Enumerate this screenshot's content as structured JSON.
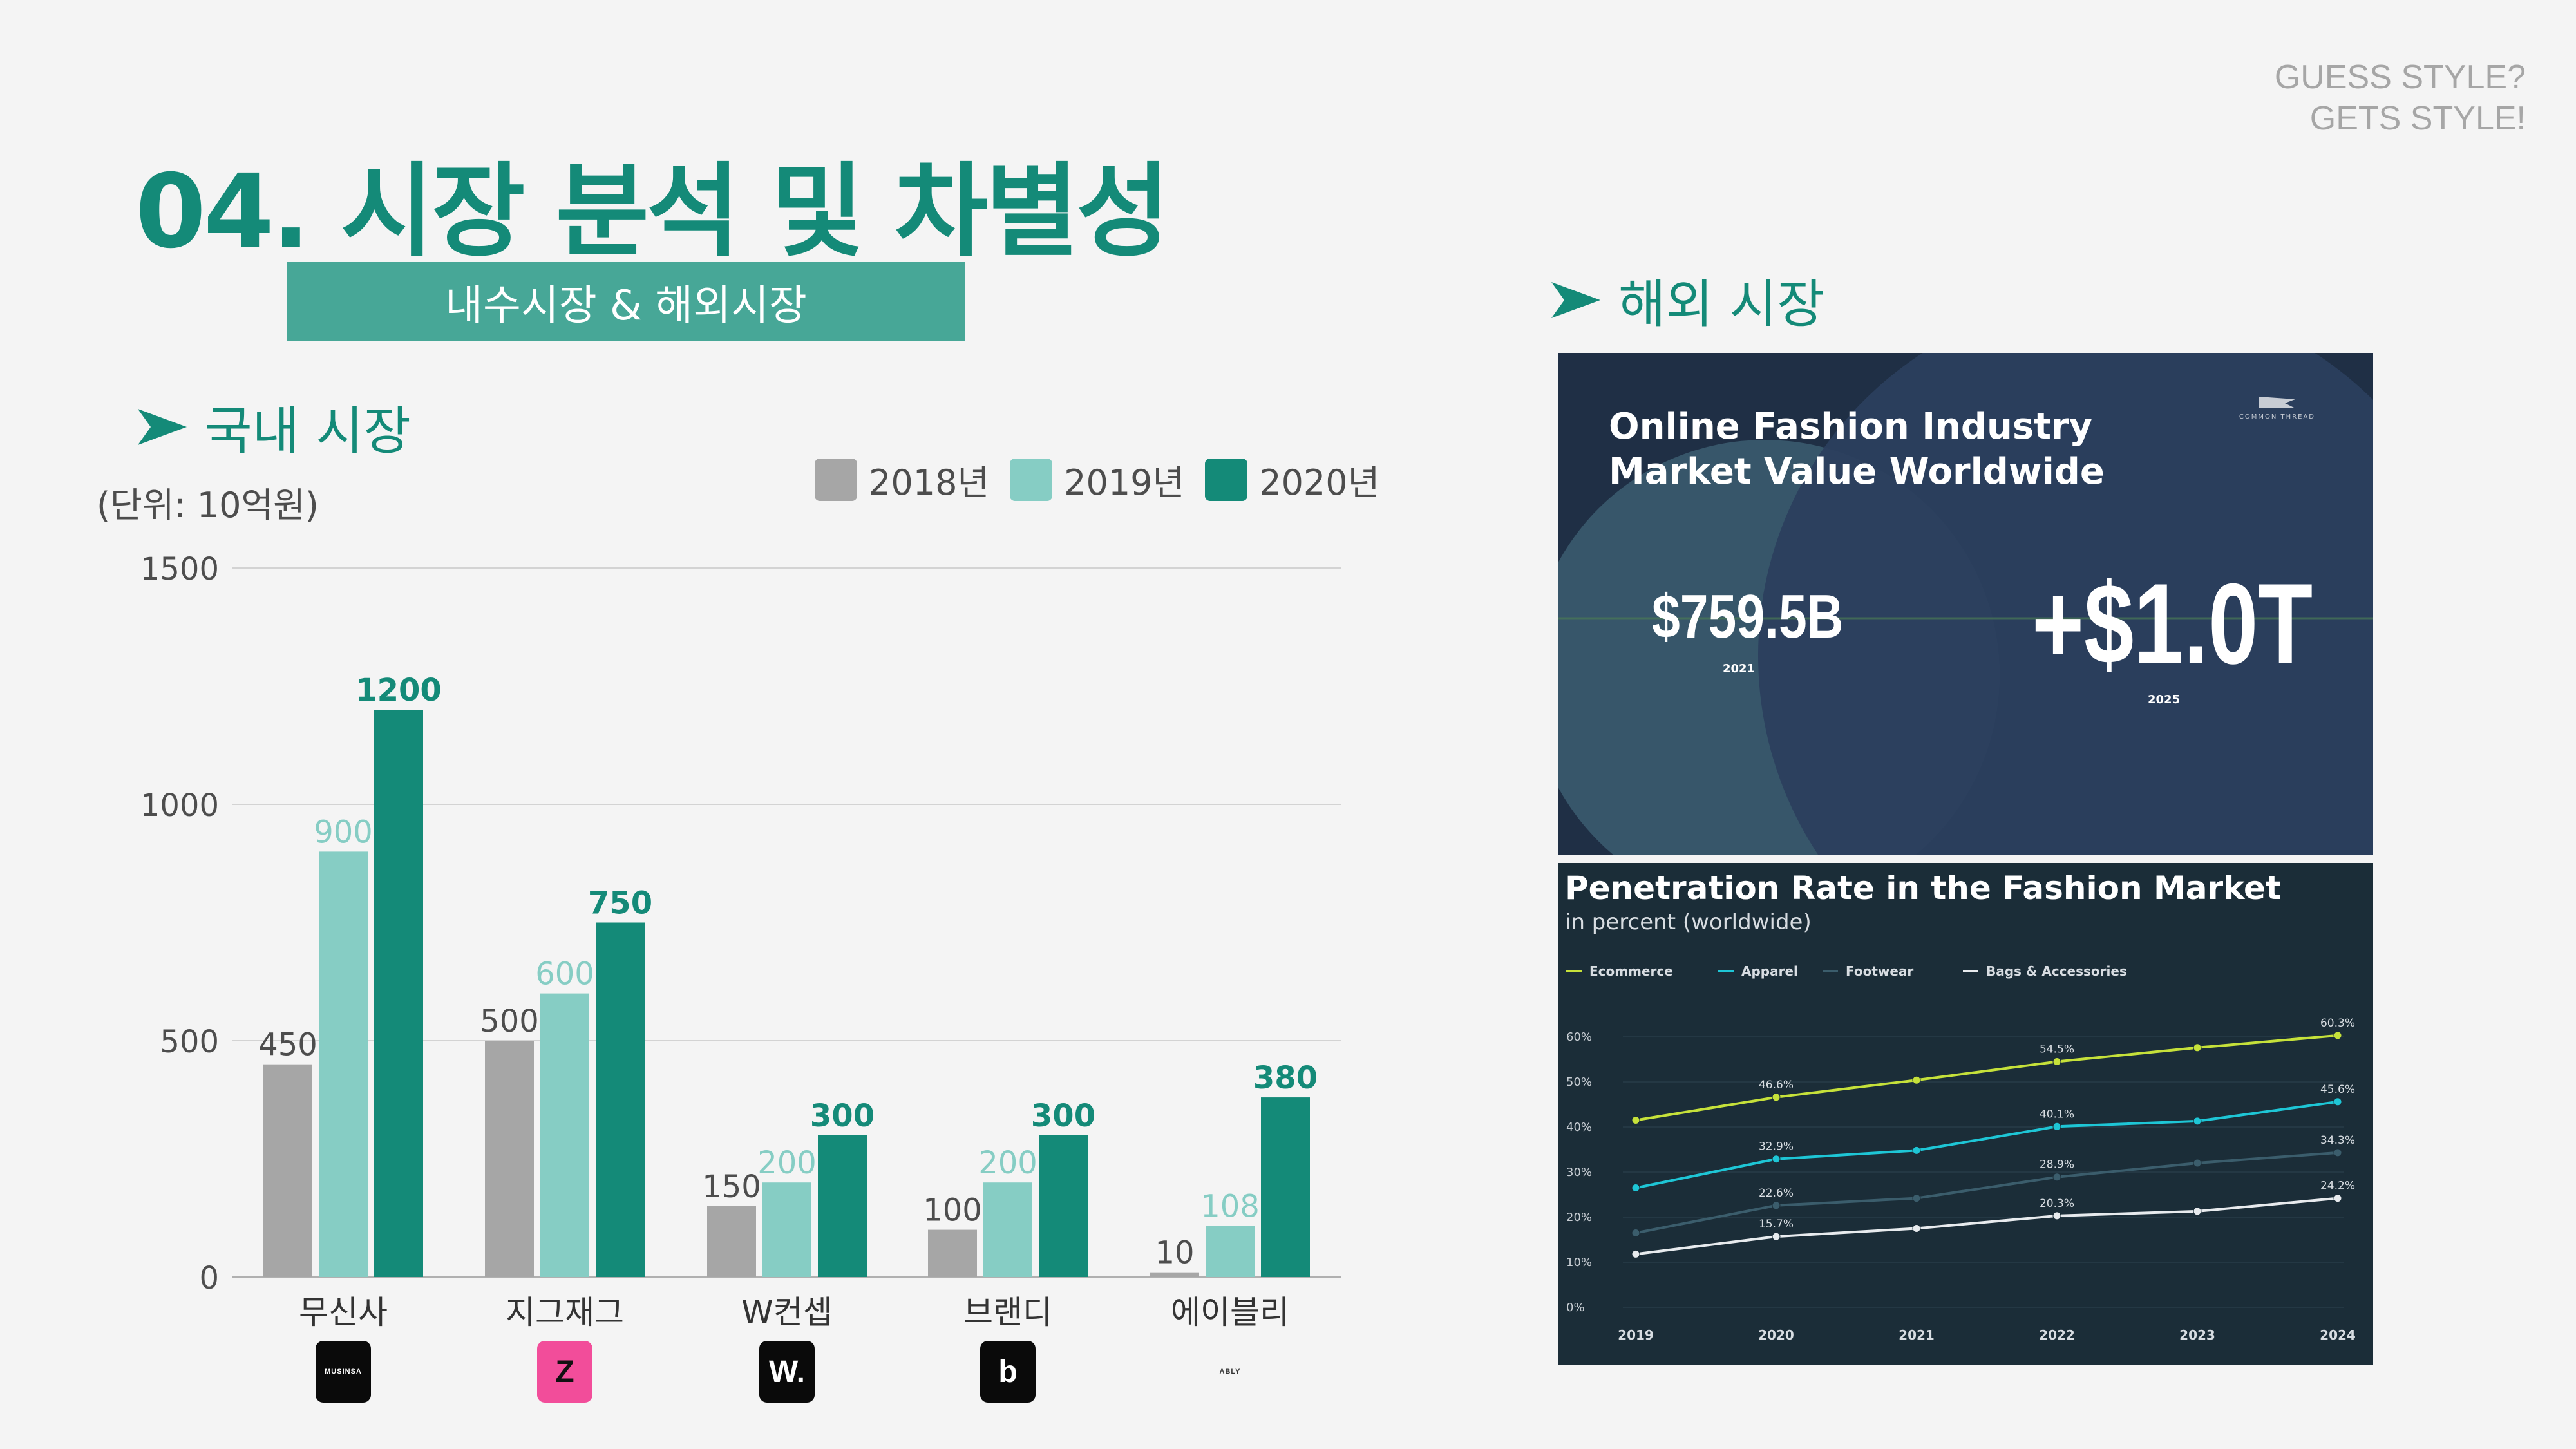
{
  "brand_tag": {
    "line1": "GUESS STYLE?",
    "line2": "GETS STYLE!"
  },
  "page_title": "04. 시장 분석 및 차별성",
  "subtitle": "내수시장 & 해외시장",
  "domestic": {
    "section_title": "국내 시장",
    "unit_label": "(단위: 10억원)",
    "companies": [
      {
        "name": "무신사",
        "logo_text": "MUSINSA",
        "logo_bg": "#0a0a0a",
        "logo_color": "#ffffff"
      },
      {
        "name": "지그재그",
        "logo_text": "Z",
        "logo_bg": "#f24d9a",
        "logo_color": "#111111"
      },
      {
        "name": "W컨셉",
        "logo_text": "W.",
        "logo_bg": "#0a0a0a",
        "logo_color": "#ffffff"
      },
      {
        "name": "브랜디",
        "logo_text": "b",
        "logo_bg": "#0a0a0a",
        "logo_color": "#ffffff"
      },
      {
        "name": "에이블리",
        "logo_text": "ABLY",
        "logo_bg": "transparent",
        "logo_color": "#333333"
      }
    ]
  },
  "overseas": {
    "section_title": "해외 시장",
    "panel1": {
      "title_line1": "Online Fashion Industry",
      "title_line2": "Market Value Worldwide",
      "value_left": "$759.5B",
      "year_left": "2021",
      "value_right": "+$1.0T",
      "year_right": "2025",
      "logo_text": "COMMON THREAD"
    },
    "panel2": {
      "title": "Penetration Rate in the Fashion Market",
      "subtitle": "in percent (worldwide)"
    }
  },
  "colors": {
    "accent": "#148a78",
    "series_2018": "#a6a6a6",
    "series_2019": "#86cdc4",
    "series_2020": "#148a78",
    "ecommerce": "#c6e13a",
    "apparel": "#1ec6d6",
    "footwear": "#3b5d6c",
    "bags": "#e8ebee"
  },
  "chart_data": [
    {
      "type": "bar",
      "title": "",
      "xlabel": "",
      "ylabel": "",
      "categories": [
        "무신사",
        "지그재그",
        "W컨셉",
        "브랜디",
        "에이블리"
      ],
      "series": [
        {
          "name": "2018년",
          "values": [
            450,
            500,
            150,
            100,
            10
          ]
        },
        {
          "name": "2019년",
          "values": [
            900,
            600,
            200,
            200,
            108
          ]
        },
        {
          "name": "2020년",
          "values": [
            1200,
            750,
            300,
            300,
            380
          ]
        }
      ],
      "ylim": [
        0,
        1500
      ],
      "yticks": [
        0,
        500,
        1000,
        1500
      ],
      "grid": true,
      "legend": "top-right"
    },
    {
      "type": "line",
      "title": "Penetration Rate in the Fashion Market",
      "subtitle": "in percent (worldwide)",
      "x": [
        "2019",
        "2020",
        "2021",
        "2022",
        "2023",
        "2024"
      ],
      "series": [
        {
          "name": "Ecommerce",
          "values": [
            41.5,
            46.6,
            50.4,
            54.5,
            57.6,
            60.3
          ],
          "point_labels": [
            null,
            "46.6%",
            null,
            "54.5%",
            null,
            "60.3%"
          ]
        },
        {
          "name": "Apparel",
          "values": [
            26.5,
            32.9,
            34.8,
            40.1,
            41.3,
            45.6
          ],
          "point_labels": [
            null,
            "32.9%",
            null,
            "40.1%",
            null,
            "45.6%"
          ]
        },
        {
          "name": "Footwear",
          "values": [
            16.5,
            22.6,
            24.2,
            28.9,
            32.0,
            34.3
          ],
          "point_labels": [
            null,
            "22.6%",
            null,
            "28.9%",
            null,
            "34.3%"
          ]
        },
        {
          "name": "Bags & Accessories",
          "values": [
            11.8,
            15.7,
            17.5,
            20.3,
            21.3,
            24.2
          ],
          "point_labels": [
            null,
            "15.7%",
            null,
            "20.3%",
            null,
            "24.2%"
          ]
        }
      ],
      "yticks": [
        "0%",
        "10%",
        "20%",
        "30%",
        "40%",
        "50%",
        "60%"
      ],
      "ylim": [
        0,
        65
      ],
      "legend": "top-left"
    }
  ]
}
